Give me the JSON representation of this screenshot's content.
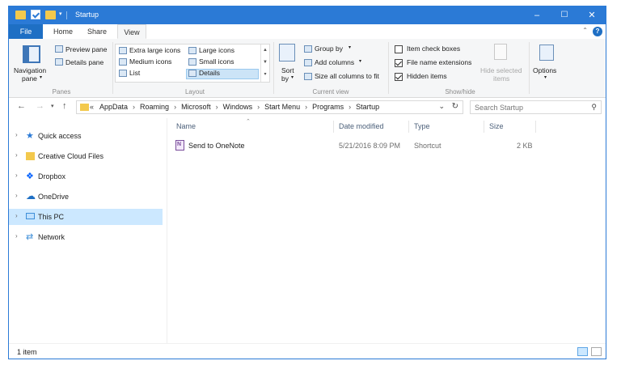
{
  "window": {
    "title": "Startup",
    "controls": {
      "minimize": "–",
      "maximize": "☐",
      "close": "✕"
    }
  },
  "ribbon_tabs": [
    "File",
    "Home",
    "Share",
    "View"
  ],
  "ribbon": {
    "panes": {
      "nav_pane_line1": "Navigation",
      "nav_pane_line2": "pane",
      "preview_pane": "Preview pane",
      "details_pane": "Details pane",
      "label": "Panes"
    },
    "layout": {
      "extra_large_icons": "Extra large icons",
      "large_icons": "Large icons",
      "medium_icons": "Medium icons",
      "small_icons": "Small icons",
      "list": "List",
      "details": "Details",
      "label": "Layout"
    },
    "current_view": {
      "sort_line1": "Sort",
      "sort_line2": "by",
      "group_by": "Group by",
      "add_columns": "Add columns",
      "size_all_columns": "Size all columns to fit",
      "label": "Current view"
    },
    "show_hide": {
      "item_check_boxes": "Item check boxes",
      "file_name_extensions": "File name extensions",
      "hidden_items": "Hidden items",
      "hide_selected_line1": "Hide selected",
      "hide_selected_line2": "items",
      "label": "Show/hide",
      "checked": {
        "item_check_boxes": false,
        "file_name_extensions": true,
        "hidden_items": true
      }
    },
    "options": {
      "label": "Options"
    }
  },
  "address": {
    "crumbs": [
      "AppData",
      "Roaming",
      "Microsoft",
      "Windows",
      "Start Menu",
      "Programs",
      "Startup"
    ],
    "search_placeholder": "Search Startup"
  },
  "nav_items": [
    {
      "label": "Quick access",
      "icon": "star-icon",
      "color": "#2b7ad6"
    },
    {
      "label": "Creative Cloud Files",
      "icon": "folder-icon",
      "color": "#f3c94d"
    },
    {
      "label": "Dropbox",
      "icon": "dropbox-icon",
      "color": "#0061fe"
    },
    {
      "label": "OneDrive",
      "icon": "cloud-icon",
      "color": "#1e6fc4"
    },
    {
      "label": "This PC",
      "icon": "computer-icon",
      "color": "#3f8fd8"
    },
    {
      "label": "Network",
      "icon": "network-icon",
      "color": "#3f8fd8"
    }
  ],
  "columns": [
    "Name",
    "Date modified",
    "Type",
    "Size"
  ],
  "files": [
    {
      "name": "Send to OneNote",
      "date": "5/21/2016 8:09 PM",
      "type": "Shortcut",
      "size": "2 KB"
    }
  ],
  "status": {
    "count": "1 item"
  }
}
